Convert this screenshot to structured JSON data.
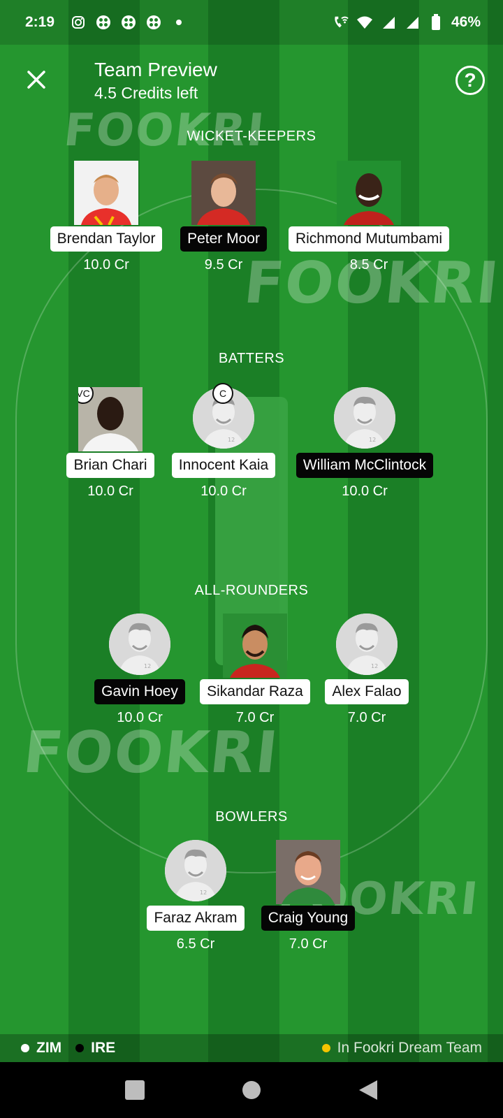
{
  "status_bar": {
    "time": "2:19",
    "battery": "46%",
    "icons": [
      "instagram-icon",
      "app-icon",
      "app-icon",
      "app-icon",
      "dot-icon",
      "wifi-call-icon",
      "wifi-icon",
      "signal-icon",
      "signal-icon",
      "battery-icon"
    ]
  },
  "header": {
    "title": "Team Preview",
    "subtitle": "4.5 Credits left",
    "help_label": "?"
  },
  "watermark": "FOOKRI",
  "sections": {
    "wicket_keepers": "WICKET-KEEPERS",
    "batters": "BATTERS",
    "all_rounders": "ALL-ROUNDERS",
    "bowlers": "BOWLERS"
  },
  "players": {
    "wk1": {
      "name": "Brendan Taylor",
      "credit": "10.0 Cr",
      "team": "ZIM"
    },
    "wk2": {
      "name": "Peter Moor",
      "credit": "9.5 Cr",
      "team": "IRE"
    },
    "wk3": {
      "name": "Richmond Mutumbami",
      "credit": "8.5 Cr",
      "team": "ZIM"
    },
    "bat1": {
      "name": "Brian Chari",
      "credit": "10.0 Cr",
      "team": "ZIM",
      "badge": "VC"
    },
    "bat2": {
      "name": "Innocent Kaia",
      "credit": "10.0 Cr",
      "team": "ZIM",
      "badge": "C"
    },
    "bat3": {
      "name": "William McClintock",
      "credit": "10.0 Cr",
      "team": "IRE"
    },
    "ar1": {
      "name": "Gavin Hoey",
      "credit": "10.0 Cr",
      "team": "IRE"
    },
    "ar2": {
      "name": "Sikandar Raza",
      "credit": "7.0 Cr",
      "team": "ZIM"
    },
    "ar3": {
      "name": "Alex Falao",
      "credit": "7.0 Cr",
      "team": "ZIM"
    },
    "bowl1": {
      "name": "Faraz Akram",
      "credit": "6.5 Cr",
      "team": "ZIM"
    },
    "bowl2": {
      "name": "Craig Young",
      "credit": "7.0 Cr",
      "team": "IRE"
    }
  },
  "legend": {
    "team1": "ZIM",
    "team2": "IRE",
    "dream_team": "In Fookri Dream Team",
    "colors": {
      "team1": "#ffffff",
      "team2": "#000000",
      "dream_team": "#f5c400"
    }
  }
}
